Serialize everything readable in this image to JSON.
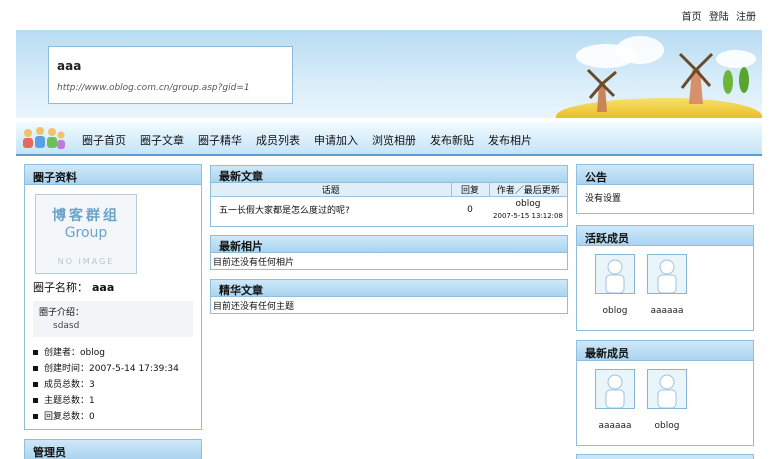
{
  "toplinks": [
    "首页",
    "登陆",
    "注册"
  ],
  "group": {
    "name": "aaa",
    "url": "http://www.oblog.com.cn/group.asp?gid=1"
  },
  "nav": [
    "圈子首页",
    "圈子文章",
    "圈子精华",
    "成员列表",
    "申请加入",
    "浏览相册",
    "发布新贴",
    "发布相片"
  ],
  "left": {
    "title": "圈子资料",
    "logo": {
      "line1": "博客群组",
      "line2": "Group",
      "line3": "NO IMAGE"
    },
    "name_label": "圈子名称：",
    "name_value": "aaa",
    "intro_label": "圈子介绍：",
    "intro_value": "sdasd",
    "stats": [
      "创建者：oblog",
      "创建时间：2007-5-14 17:39:34",
      "成员总数：3",
      "主题总数：1",
      "回复总数：0"
    ],
    "admin_title": "管理员"
  },
  "articles": {
    "title": "最新文章",
    "headers": [
      "话题",
      "回复",
      "作者／最后更新"
    ],
    "rows": [
      {
        "topic": "五一长假大家都是怎么度过的呢?",
        "replies": "0",
        "author": "oblog",
        "updated": "2007-5-15 13:12:08"
      }
    ]
  },
  "photos": {
    "title": "最新相片",
    "empty": "目前还没有任何相片"
  },
  "featured": {
    "title": "精华文章",
    "empty": "目前还没有任何主题"
  },
  "notice": {
    "title": "公告",
    "text": "没有设置"
  },
  "active": {
    "title": "活跃成员",
    "members": [
      "oblog",
      "aaaaaa"
    ]
  },
  "newest": {
    "title": "最新成员",
    "members": [
      "aaaaaa",
      "oblog"
    ]
  },
  "colors": {
    "panel_border": "#8fbfdd",
    "header_gradient": "#a9d4f0",
    "accent": "#5b9ed0"
  }
}
